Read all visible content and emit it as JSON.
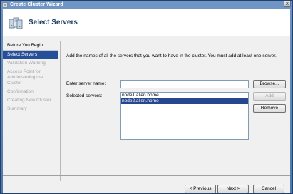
{
  "window": {
    "title": "Create Cluster Wizard",
    "close_glyph": "x"
  },
  "header": {
    "title": "Select Servers",
    "icon": "cluster-servers-icon"
  },
  "steps": [
    {
      "label": "Before You Begin",
      "state": "done"
    },
    {
      "label": "Select Servers",
      "state": "active"
    },
    {
      "label": "Validation Warning",
      "state": "pending"
    },
    {
      "label": "Access Point for Administering the Cluster",
      "state": "pending"
    },
    {
      "label": "Confirmation",
      "state": "pending"
    },
    {
      "label": "Creating New Cluster",
      "state": "pending"
    },
    {
      "label": "Summary",
      "state": "pending"
    }
  ],
  "main": {
    "description": "Add the names of all the servers that you want to have in the cluster. You must add at least one server.",
    "server_name_label": "Enter server name:",
    "server_name_value": "",
    "browse_label": "Browse...",
    "selected_label": "Selected servers:",
    "add_label": "Add",
    "remove_label": "Remove",
    "servers": [
      "node1.allen.home",
      "node2.allen.home"
    ],
    "selected_index": 1
  },
  "footer": {
    "previous_label": "< Previous",
    "next_label": "Next >",
    "cancel_label": "Cancel"
  },
  "colors": {
    "selection": "#26468f",
    "title_text": "#ffffff",
    "header_title": "#1d3a63"
  }
}
